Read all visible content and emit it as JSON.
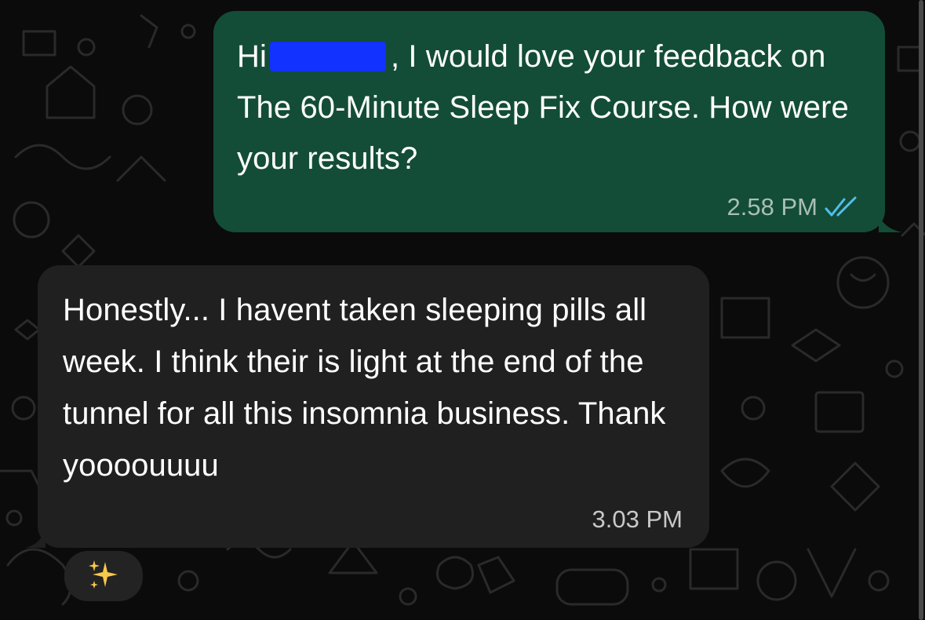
{
  "chat": {
    "sent": {
      "greeting": "Hi",
      "text_after_redaction": ", I would love your feedback on The 60-Minute Sleep Fix Course. How were your results?",
      "time": "2.58 PM",
      "status_icon": "double-check-read-icon",
      "bubble_color": "#134d37",
      "check_color": "#53bdeb"
    },
    "received": {
      "text": "Honestly... I havent taken sleeping pills all week. I think their is light at the end of the tunnel for all this insomnia business. Thank yoooouuuu",
      "time": "3.03 PM",
      "bubble_color": "#202020"
    },
    "reaction": {
      "icon": "sparkles-icon",
      "color": "#f7c94a"
    }
  }
}
